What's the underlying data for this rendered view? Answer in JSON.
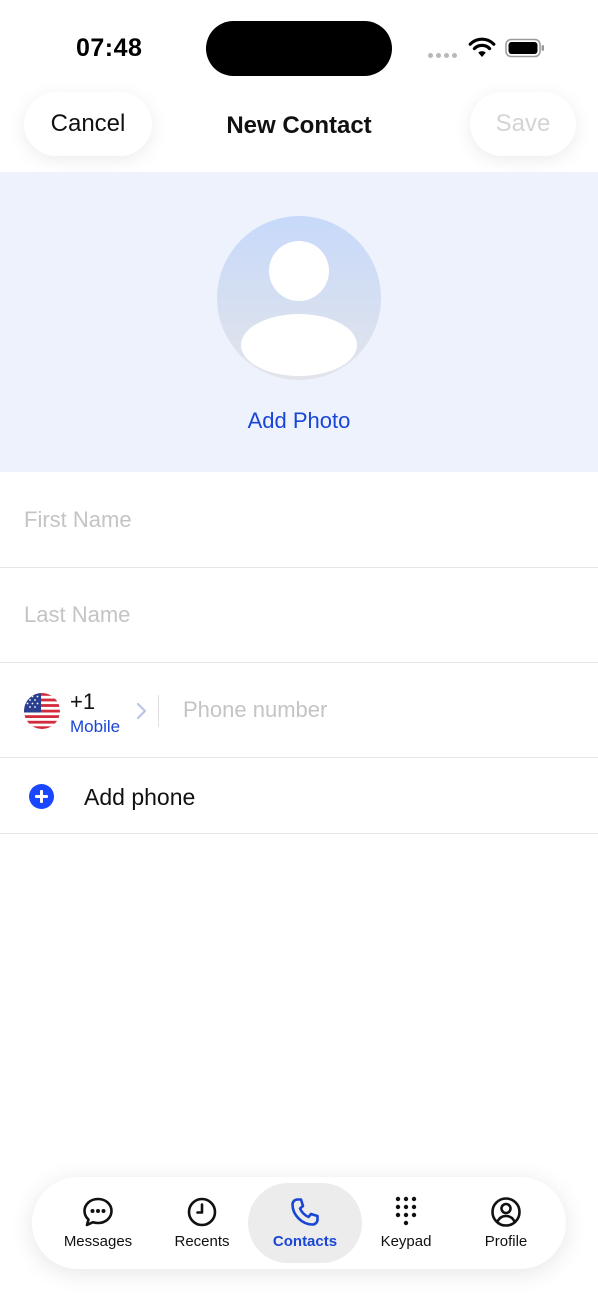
{
  "status_bar": {
    "time": "07:48",
    "icons": [
      "signal-icon",
      "wifi-icon",
      "battery-icon"
    ]
  },
  "header": {
    "cancel_label": "Cancel",
    "title": "New Contact",
    "save_label": "Save"
  },
  "photo": {
    "add_photo_label": "Add Photo",
    "icon": "avatar-placeholder-icon"
  },
  "form": {
    "first_name": {
      "placeholder": "First Name",
      "value": ""
    },
    "last_name": {
      "placeholder": "Last Name",
      "value": ""
    },
    "phone": {
      "country_flag": "us-flag-icon",
      "country_code": "+1",
      "type": "Mobile",
      "placeholder": "Phone number",
      "value": ""
    },
    "add_phone_label": "Add phone"
  },
  "tab_bar": {
    "active": "Contacts",
    "tabs": [
      {
        "label": "Messages",
        "icon": "chat-bubble-icon"
      },
      {
        "label": "Recents",
        "icon": "clock-icon"
      },
      {
        "label": "Contacts",
        "icon": "phone-icon"
      },
      {
        "label": "Keypad",
        "icon": "keypad-icon"
      },
      {
        "label": "Profile",
        "icon": "user-circle-icon"
      }
    ]
  },
  "colors": {
    "accent": "#1a46d6",
    "add_button": "#1a46ff",
    "photo_background": "#edf2fc",
    "placeholder": "#c4c4c4",
    "save_disabled": "#d4d4d4"
  }
}
